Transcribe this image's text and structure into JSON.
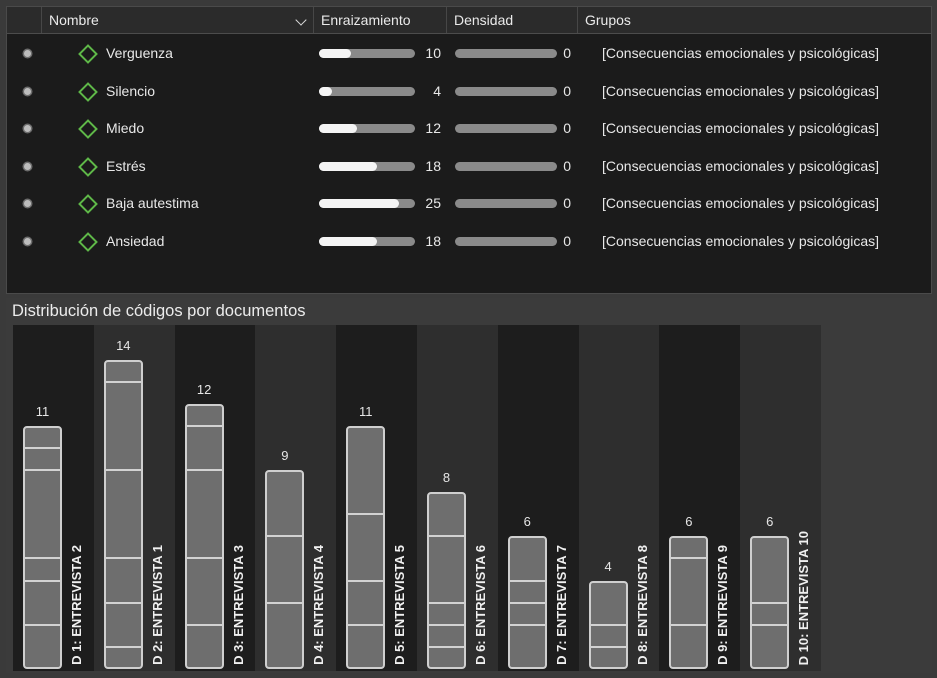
{
  "table": {
    "headers": [
      "Nombre",
      "Enraizamiento",
      "Densidad",
      "Grupos"
    ],
    "rows": [
      {
        "name": "Verguenza",
        "enraizamiento": 10,
        "densidad": 0,
        "grupos": "[Consecuencias emocionales y psicológicas]"
      },
      {
        "name": "Silencio",
        "enraizamiento": 4,
        "densidad": 0,
        "grupos": "[Consecuencias emocionales y psicológicas]"
      },
      {
        "name": "Miedo",
        "enraizamiento": 12,
        "densidad": 0,
        "grupos": "[Consecuencias emocionales y psicológicas]"
      },
      {
        "name": "Estrés",
        "enraizamiento": 18,
        "densidad": 0,
        "grupos": "[Consecuencias emocionales y psicológicas]"
      },
      {
        "name": "Baja autestima",
        "enraizamiento": 25,
        "densidad": 0,
        "grupos": "[Consecuencias emocionales y psicológicas]"
      },
      {
        "name": "Ansiedad",
        "enraizamiento": 18,
        "densidad": 0,
        "grupos": "[Consecuencias emocionales y psicológicas]"
      }
    ],
    "bar_max": 30,
    "icons": {
      "row": "code-dot-icon",
      "code": "green-diamond-icon",
      "sort": "chevron-down-icon"
    },
    "colors": {
      "code_icon": "#5fb848",
      "bar_fill": "#f4f4f4",
      "bar_track": "#8a8a8a"
    }
  },
  "chart": {
    "title": "Distribución de códigos por documentos"
  },
  "chart_data": {
    "type": "bar",
    "title": "Distribución de códigos por documentos",
    "categories": [
      "D 1: ENTREVISTA 2",
      "D 2: ENTREVISTA 1",
      "D 3: ENTREVISTA 3",
      "D 4: ENTREVISTA 4",
      "D 5: ENTREVISTA 5",
      "D 6: ENTREVISTA 6",
      "D 7: ENTREVISTA 7",
      "D 8: ENTREVISTA 8",
      "D 9: ENTREVISTA 9",
      "D 10: ENTREVISTA 10"
    ],
    "values": [
      11,
      14,
      12,
      9,
      11,
      8,
      6,
      4,
      6,
      6
    ],
    "stacks": [
      [
        1,
        1,
        4,
        1,
        2,
        2
      ],
      [
        1,
        4,
        4,
        2,
        2,
        1
      ],
      [
        1,
        2,
        4,
        3,
        2
      ],
      [
        3,
        3,
        3
      ],
      [
        4,
        3,
        2,
        2
      ],
      [
        2,
        3,
        1,
        1,
        1
      ],
      [
        2,
        1,
        1,
        2
      ],
      [
        2,
        1,
        1
      ],
      [
        1,
        3,
        2
      ],
      [
        3,
        1,
        2
      ]
    ],
    "ylim": [
      0,
      15
    ]
  }
}
